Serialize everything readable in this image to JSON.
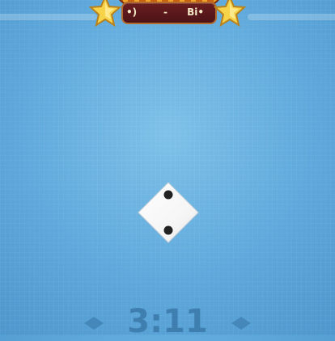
{
  "colors": {
    "background": "#5fa9dc",
    "banner_plate": "#5a181b",
    "star": "#f7d34a",
    "die_face": "#ffffff",
    "pip": "#222222",
    "timer": "#3f7fb0"
  },
  "banner": {
    "left_player": "•)",
    "separator": "-",
    "right_player": "Bi•"
  },
  "die": {
    "value": 2
  },
  "timer": {
    "text": "3:11"
  },
  "icons": [
    "star-icon",
    "diamond-icon"
  ]
}
